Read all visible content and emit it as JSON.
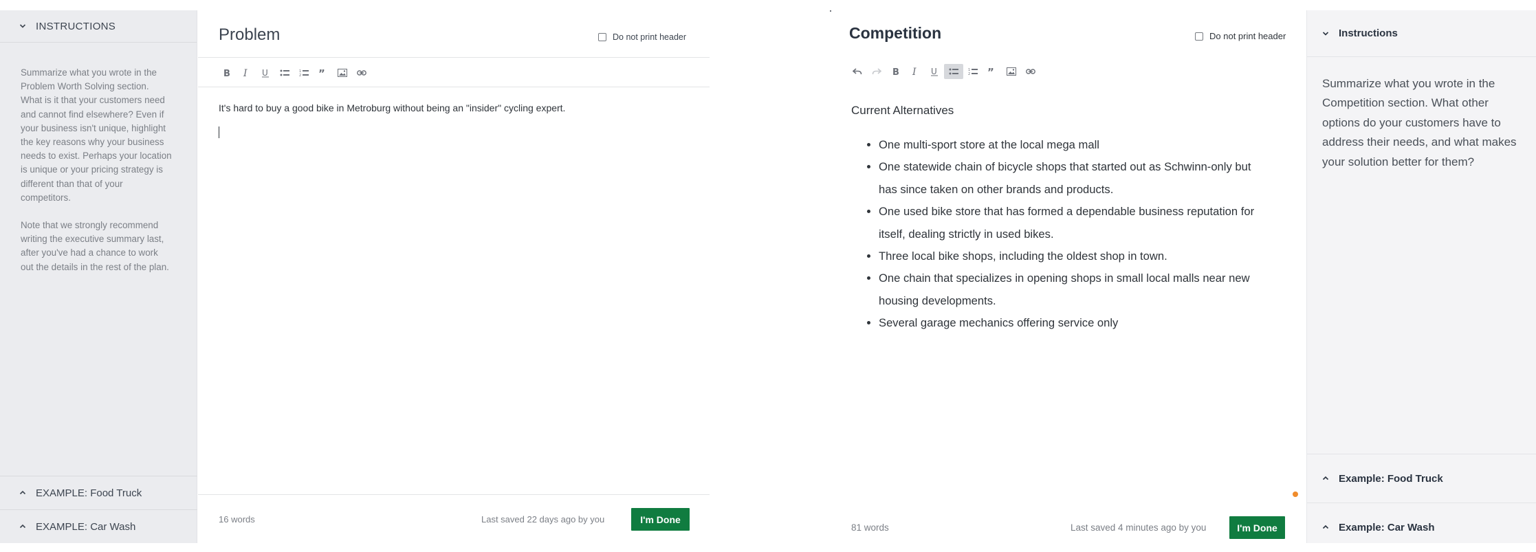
{
  "left_panel": {
    "header": "INSTRUCTIONS",
    "paragraphs": [
      "Summarize what you wrote in the Problem Worth Solving section. What is it that your customers need and cannot find elsewhere? Even if your business isn't unique, highlight the key reasons why your business needs to exist. Perhaps your location is unique or your pricing strategy is different than that of your competitors.",
      "Note that we strongly recommend writing the executive summary last, after you've had a chance to work out the details in the rest of the plan."
    ],
    "examples": [
      "EXAMPLE: Food Truck",
      "EXAMPLE: Car Wash"
    ]
  },
  "problem_editor": {
    "title": "Problem",
    "no_print_label": "Do not print header",
    "body": "It's hard to buy a good bike in Metroburg without being an \"insider\" cycling expert.",
    "word_count": "16 words",
    "last_saved": "Last saved 22 days ago by you",
    "done_label": "I'm Done"
  },
  "competition_editor": {
    "title": "Competition",
    "no_print_label": "Do not print header",
    "heading": "Current Alternatives",
    "items": [
      "One multi-sport store at the local mega mall",
      "One statewide chain of bicycle shops that started out as Schwinn-only but has since taken on other brands and products.",
      "One used bike store that has formed a dependable business reputation for itself, dealing strictly in used bikes.",
      "Three local bike shops, including the oldest shop in town.",
      "One chain that specializes in opening shops in small local malls near new housing developments.",
      "Several garage mechanics offering service only"
    ],
    "word_count": "81 words",
    "last_saved": "Last saved 4 minutes ago by you",
    "done_label": "I'm Done"
  },
  "right_panel": {
    "header": "Instructions",
    "text": "Summarize what you wrote in the Competition section. What other options do your customers have to address their needs, and what makes your solution better for them?",
    "examples": [
      "Example: Food Truck",
      "Example: Car Wash"
    ]
  },
  "colors": {
    "done_button": "#107c40",
    "left_panel_bg": "#ebecef",
    "right_panel_bg": "#f4f4f6",
    "notification_dot": "#f08c2c"
  }
}
